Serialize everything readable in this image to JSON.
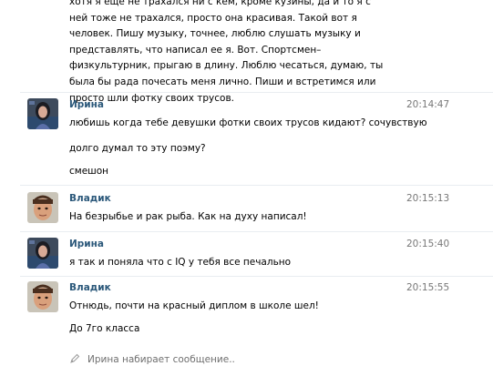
{
  "previous_message": {
    "text": "хотя я еще не трахался ни с кем, кроме кузины, да и то я с ней тоже не трахался, просто она красивая. Такой вот я человек. Пишу музыку, точнее, люблю слушать музыку и представлять, что написал ее я. Вот. Спортсмен–физкультурник, прыгаю в длину. Люблю чесаться, думаю, ты была бы рада почесать меня лично. Пиши и встретимся или просто шли фотку своих трусов."
  },
  "messages": [
    {
      "author": "Ирина",
      "time": "20:14:47",
      "avatar_icon": "user-avatar-female",
      "lines": [
        "любишь когда тебе девушки фотки своих трусов кидают? сочувствую",
        "долго думал то эту поэму?",
        "смешон"
      ]
    },
    {
      "author": "Владик",
      "time": "20:15:13",
      "avatar_icon": "user-avatar-male",
      "lines": [
        "На безрыбье и рак рыба. Как на духу написал!"
      ]
    },
    {
      "author": "Ирина",
      "time": "20:15:40",
      "avatar_icon": "user-avatar-female",
      "lines": [
        "я так и поняла что с IQ у тебя все печально"
      ]
    },
    {
      "author": "Владик",
      "time": "20:15:55",
      "avatar_icon": "user-avatar-male",
      "lines": [
        "Отнюдь, почти на красный диплом в школе шел!",
        "До 7го класса"
      ]
    }
  ],
  "typing_indicator": {
    "text": "Ирина набирает сообщение..",
    "icon": "pencil-icon"
  },
  "colors": {
    "author_link": "#2b587a",
    "timestamp": "#777777",
    "divider": "#e9edf1"
  }
}
